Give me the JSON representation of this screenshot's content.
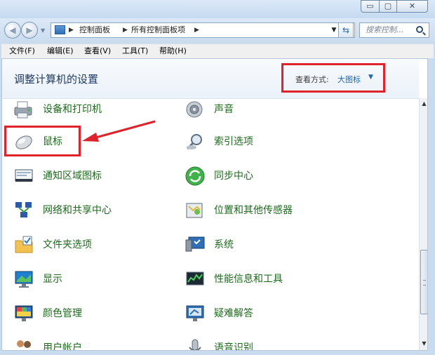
{
  "window": {
    "min_glyph": "▭",
    "max_glyph": "▢",
    "close_glyph": "✕"
  },
  "nav": {
    "back_glyph": "◀",
    "fwd_glyph": "▶",
    "breadcrumbs": [
      "控制面板",
      "所有控制面板项"
    ],
    "search_placeholder": "搜索控制..."
  },
  "menu": [
    "文件(F)",
    "编辑(E)",
    "查看(V)",
    "工具(T)",
    "帮助(H)"
  ],
  "header": {
    "title": "调整计算机的设置",
    "view_label": "查看方式:",
    "view_value": "大图标"
  },
  "items_left": [
    {
      "label": "设备和打印机",
      "icon": "printer-icon"
    },
    {
      "label": "鼠标",
      "icon": "mouse-icon"
    },
    {
      "label": "通知区域图标",
      "icon": "notification-area-icon"
    },
    {
      "label": "网络和共享中心",
      "icon": "network-icon"
    },
    {
      "label": "文件夹选项",
      "icon": "folder-options-icon"
    },
    {
      "label": "显示",
      "icon": "display-icon"
    },
    {
      "label": "颜色管理",
      "icon": "color-management-icon"
    },
    {
      "label": "用户帐户",
      "icon": "user-accounts-icon"
    }
  ],
  "items_right": [
    {
      "label": "声音",
      "icon": "speaker-icon"
    },
    {
      "label": "索引选项",
      "icon": "index-search-icon"
    },
    {
      "label": "同步中心",
      "icon": "sync-icon"
    },
    {
      "label": "位置和其他传感器",
      "icon": "location-sensor-icon"
    },
    {
      "label": "系统",
      "icon": "system-icon"
    },
    {
      "label": "性能信息和工具",
      "icon": "performance-icon"
    },
    {
      "label": "疑难解答",
      "icon": "troubleshooting-icon"
    },
    {
      "label": "语音识别",
      "icon": "speech-recognition-icon"
    }
  ],
  "colors": {
    "link_green": "#1c6b1c",
    "highlight_red": "#e0232a",
    "title_blue": "#1f3a63",
    "view_blue": "#1e66b8"
  }
}
